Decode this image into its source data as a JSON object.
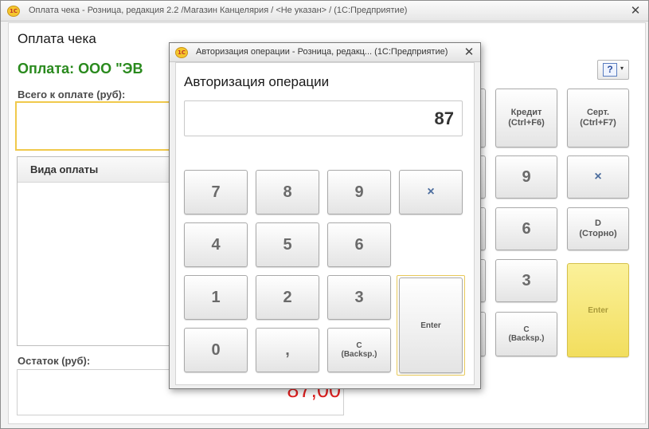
{
  "main_window": {
    "title": "Оплата чека - Розница, редакция 2.2 /Магазин Канцелярия / <Не указан> /  (1С:Предприятие)",
    "logo_text": "1С",
    "close_glyph": "✕",
    "form_title": "Оплата чека",
    "payer_text": "Оплата: ООО \"ЭВ",
    "total_label": "Всего к оплате (руб):",
    "payments_table": {
      "column_header": "Вида оплаты"
    },
    "remainder_label": "Остаток (руб):",
    "remainder_value": "87,00",
    "help_button": {
      "glyph": "?",
      "caret": "▾"
    },
    "keypad": {
      "credit": "Кредит\n(Ctrl+F6)",
      "certificate": "Серт.\n(Ctrl+F7)",
      "nine": "9",
      "multiply": "×",
      "six": "6",
      "storno": "D\n(Сторно)",
      "three": "3",
      "backspace": "C\n(Backsp.)",
      "enter": "Enter"
    }
  },
  "dialog": {
    "title": "Авторизация операции - Розница, редакц...  (1С:Предприятие)",
    "logo_text": "1С",
    "close_glyph": "✕",
    "heading": "Авторизация операции",
    "amount": "87",
    "keys": {
      "seven": "7",
      "eight": "8",
      "nine": "9",
      "multiply": "×",
      "four": "4",
      "five": "5",
      "six": "6",
      "one": "1",
      "two": "2",
      "three": "3",
      "zero": "0",
      "comma": ",",
      "backspace": "C\n(Backsp.)",
      "enter": "Enter"
    }
  },
  "colors": {
    "payer_text": "#2a8a1e",
    "remainder_value": "#e02020",
    "highlight_border": "#f0c94c",
    "enter_key": "#f2de5e"
  }
}
